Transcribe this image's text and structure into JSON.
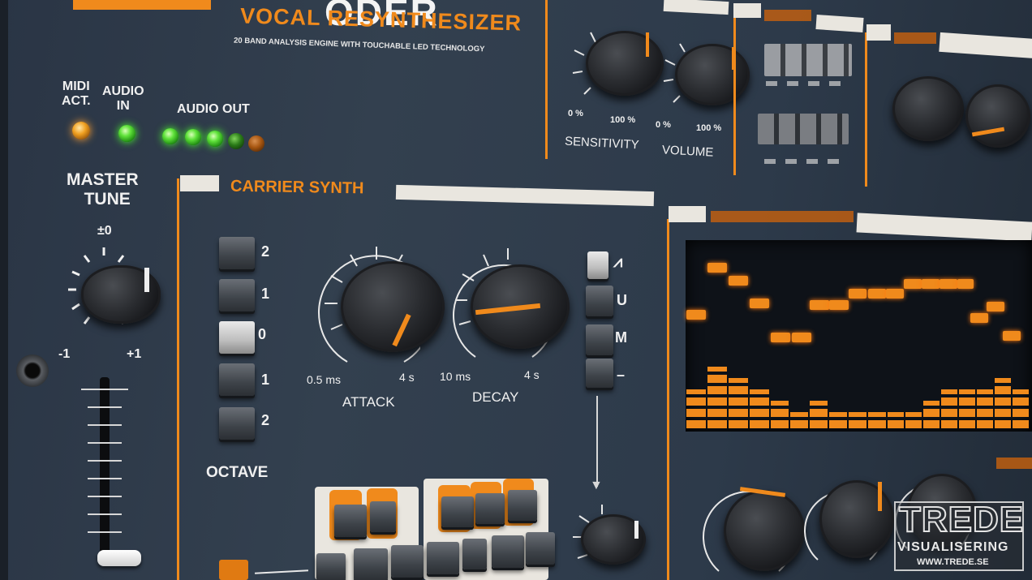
{
  "header": {
    "brand_partial": "ODER",
    "subtitle": "VOCAL RESYNTHESIZER",
    "tagline": "20 BAND ANALYSIS ENGINE WITH TOUCHABLE LED TECHNOLOGY"
  },
  "indicators": {
    "midi_label": "MIDI\nACT.",
    "audio_in_label": "AUDIO\nIN",
    "audio_out_label": "AUDIO OUT"
  },
  "master_tune": {
    "title": "MASTER\nTUNE",
    "center": "±0",
    "min": "-1",
    "max": "+1"
  },
  "carrier": {
    "title": "CARRIER SYNTH",
    "octave_label": "OCTAVE",
    "octave_values": [
      "2",
      "1",
      "0",
      "1",
      "2"
    ],
    "attack": {
      "label": "ATTACK",
      "min": "0.5 ms",
      "max": "4 s"
    },
    "decay": {
      "label": "DECAY",
      "min": "10 ms",
      "max": "4 s"
    },
    "wave_symbols": [
      "⩘",
      "U",
      "M",
      "–"
    ]
  },
  "top_controls": {
    "sensitivity": {
      "label": "SENSITIVITY",
      "min": "0 %",
      "max": "100 %"
    },
    "volume": {
      "label": "VOLUME",
      "min": "0 %",
      "max": "100 %"
    }
  },
  "watermark": {
    "title": "TREDE",
    "line2": "VISUALISERING",
    "url": "WWW.TREDE.SE"
  },
  "colors": {
    "accent": "#f08a1c",
    "panel": "#33404f",
    "led_green": "#4cff2c"
  }
}
